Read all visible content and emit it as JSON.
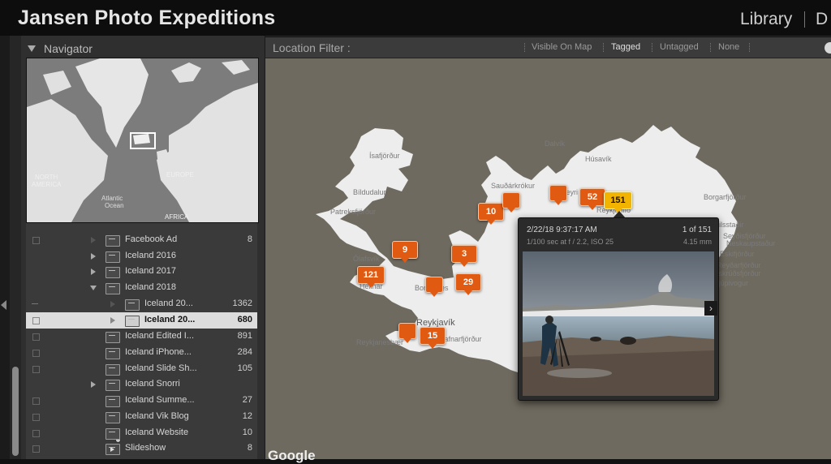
{
  "app": {
    "title": "Jansen Photo Expeditions",
    "modules": [
      "Library",
      "D"
    ]
  },
  "navigator": {
    "title": "Navigator",
    "labels": {
      "north": "NORTH",
      "america": "AMERICA",
      "atlantic": "Atlantic",
      "ocean": "Ocean",
      "europe": "EUROPE",
      "africa": "AFRICA"
    }
  },
  "folders": [
    {
      "name": "Facebook Ad",
      "count": "8",
      "expander": "none"
    },
    {
      "name": "Iceland 2016",
      "count": "",
      "expander": "collapsed"
    },
    {
      "name": "Iceland 2017",
      "count": "",
      "expander": "collapsed"
    },
    {
      "name": "Iceland 2018",
      "count": "",
      "expander": "expanded"
    },
    {
      "name": "Iceland 20...",
      "count": "1362",
      "expander": "faint"
    },
    {
      "name": "Iceland 20...",
      "count": "680",
      "expander": "faint",
      "selected": true
    },
    {
      "name": "Iceland Edited I...",
      "count": "891",
      "expander": "none"
    },
    {
      "name": "Iceland iPhone...",
      "count": "284",
      "expander": "none"
    },
    {
      "name": "Iceland Slide Sh...",
      "count": "105",
      "expander": "none"
    },
    {
      "name": "Iceland Snorri",
      "count": "",
      "expander": "collapsed"
    },
    {
      "name": "Iceland Summe...",
      "count": "27",
      "expander": "none"
    },
    {
      "name": "Iceland Vik Blog",
      "count": "12",
      "expander": "none"
    },
    {
      "name": "Iceland Website",
      "count": "10",
      "expander": "none"
    },
    {
      "name": "Slideshow",
      "count": "8",
      "expander": "none"
    }
  ],
  "location_filter": {
    "label": "Location Filter :",
    "options": [
      "Visible On Map",
      "Tagged",
      "Untagged",
      "None"
    ],
    "active": "Tagged"
  },
  "map": {
    "places": {
      "isafjordur": "Ísafjörður",
      "bildudalur": "Bíldudalur",
      "patreksfjordur": "Patreksfjörður",
      "olafsvik": "Ólafsvík",
      "hellnar": "Hellnar",
      "borgarnes": "Borgarnes",
      "reykjavik": "Reykjavík",
      "hafnarfjordur": "Hafnarfjörður",
      "reykjanesbaer": "Reykjanesbær",
      "saudarkrokur": "Sauðárkrókur",
      "husavik": "Húsavík",
      "dalvik": "Dalvík",
      "akureyri": "Akureyri",
      "reykjahlid": "Reykjahlíð",
      "borgarfjordur": "Borgarfjörður",
      "egilsstadir": "Egilsstaðir",
      "seydisfjordur": "Seyðisfjörður",
      "eskifjordur": "Eskifjörður",
      "faskrudsfjordur": "Fáskrúðsfjörður",
      "djupivogur": "Djúpivogur",
      "reydarfjordur": "Reyðarfjörður",
      "neskaupstadur": "Neskaupstaður"
    },
    "clusters": [
      "121",
      "9",
      "3",
      "29",
      "15",
      "10",
      "52",
      "151"
    ],
    "google_label": "Google"
  },
  "popup": {
    "datetime": "2/22/18 9:37:17 AM",
    "index": "1 of 151",
    "exposure": "1/100 sec at f / 2.2, ISO 25",
    "focal": "4.15 mm"
  }
}
